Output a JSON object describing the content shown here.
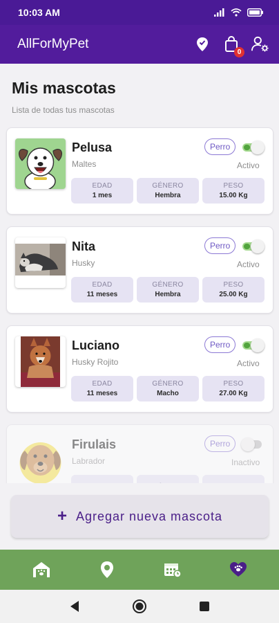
{
  "status_bar": {
    "time": "10:03 AM"
  },
  "app": {
    "title": "AllForMyPet",
    "cart_count": "0"
  },
  "page": {
    "title": "Mis mascotas",
    "subtitle": "Lista de todas tus mascotas"
  },
  "stat_labels": {
    "age": "EDAD",
    "gender": "GÉNERO",
    "weight": "PESO"
  },
  "pets": [
    {
      "name": "Pelusa",
      "breed": "Maltes",
      "species": "Perro",
      "status": "Activo",
      "active": true,
      "age": "1 mes",
      "gender": "Hembra",
      "weight": "15.00 Kg",
      "photo": "cartoon-dog-photo"
    },
    {
      "name": "Nita",
      "breed": "Husky",
      "species": "Perro",
      "status": "Activo",
      "active": true,
      "age": "11 meses",
      "gender": "Hembra",
      "weight": "25.00 Kg",
      "photo": "husky-photo"
    },
    {
      "name": "Luciano",
      "breed": "Husky Rojito",
      "species": "Perro",
      "status": "Activo",
      "active": true,
      "age": "11 meses",
      "gender": "Macho",
      "weight": "27.00 Kg",
      "photo": "red-husky-photo"
    },
    {
      "name": "Firulais",
      "breed": "Labrador",
      "species": "Perro",
      "status": "Inactivo",
      "active": false,
      "age": "",
      "gender": "",
      "weight": "",
      "photo": "labrador-cartoon-photo"
    }
  ],
  "add_button": {
    "label": "Agregar nueva mascota"
  },
  "colors": {
    "primary": "#521c9c",
    "status_bar": "#4a1a96",
    "nav_green": "#6fa35a",
    "chip": "#6e58c4",
    "toggle_on": "#52a43e",
    "badge": "#e03131"
  },
  "icons": {
    "app_bar": [
      "location-pin-icon",
      "shopping-bag-icon",
      "user-settings-icon"
    ],
    "bottom_nav": [
      "home-pet-icon",
      "map-marker-icon",
      "calendar-icon",
      "heart-paw-icon"
    ],
    "system_nav": [
      "back-icon",
      "home-icon",
      "recents-icon"
    ]
  }
}
